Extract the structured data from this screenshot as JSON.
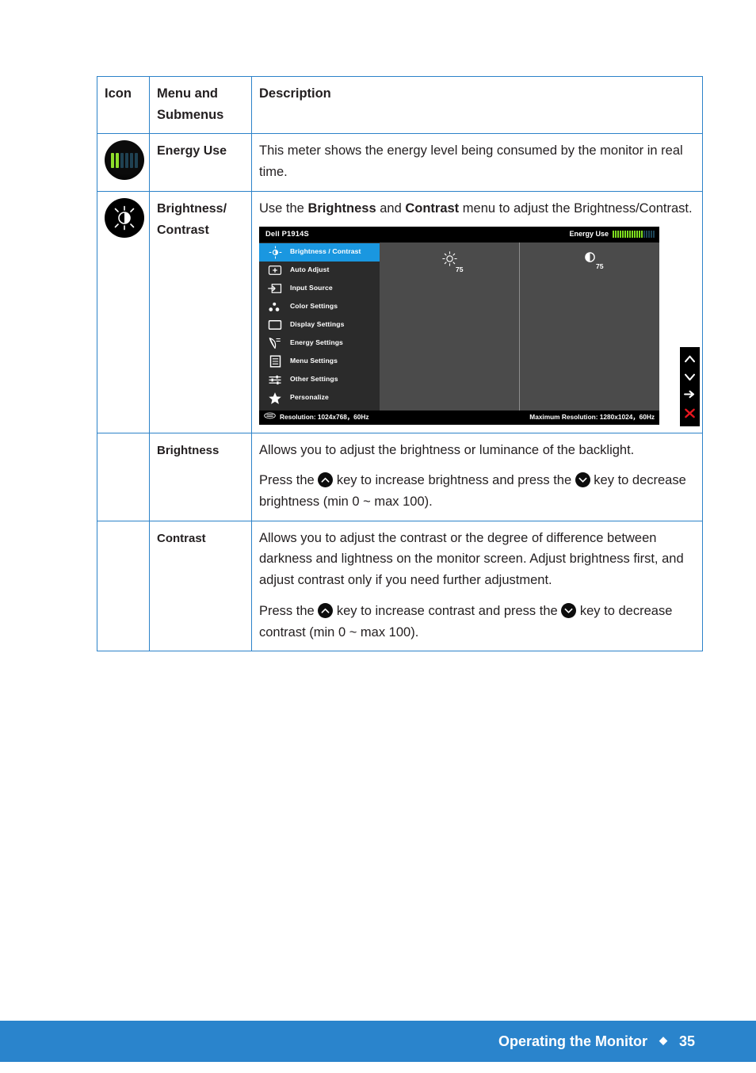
{
  "table": {
    "headers": {
      "icon": "Icon",
      "menu_line1": "Menu and",
      "menu_line2": "Submenus",
      "description": "Description"
    },
    "rows": [
      {
        "icon_name": "energy-use-icon",
        "menu": "Energy Use",
        "desc_paragraphs": [
          "This meter shows the energy level being consumed by the monitor in real time."
        ]
      },
      {
        "icon_name": "brightness-contrast-icon",
        "menu_line1": "Brightness/",
        "menu_line2": "Contrast",
        "desc_intro_1": "Use the ",
        "desc_intro_bold_1": "Brightness",
        "desc_intro_2": " and ",
        "desc_intro_bold_2": "Contrast",
        "desc_intro_3": " menu to adjust the Brightness/Contrast."
      },
      {
        "menu": "Brightness",
        "para1": "Allows you to adjust the brightness or luminance of the backlight.",
        "para2_a": "Press the ",
        "para2_b": " key to increase brightness and press the ",
        "para2_c": " key to decrease brightness (min 0 ~ max 100)."
      },
      {
        "menu": "Contrast",
        "para1": "Allows you to adjust the contrast or the degree of difference between darkness and lightness on the monitor screen. Adjust brightness first, and adjust contrast only if you need further adjustment.",
        "para2_a": "Press the ",
        "para2_b": "  key to increase contrast and press the ",
        "para2_c": " key to decrease contrast (min 0 ~ max 100)."
      }
    ]
  },
  "osd": {
    "title": "Dell P1914S",
    "energy_use_label": "Energy Use",
    "energy_bars_on": 13,
    "energy_bars_off": 5,
    "menu_items": [
      {
        "label": "Brightness / Contrast",
        "icon": "brightness-contrast-icon",
        "active": true
      },
      {
        "label": "Auto Adjust",
        "icon": "auto-adjust-icon",
        "active": false
      },
      {
        "label": "Input Source",
        "icon": "input-source-icon",
        "active": false
      },
      {
        "label": "Color Settings",
        "icon": "color-settings-icon",
        "active": false
      },
      {
        "label": "Display Settings",
        "icon": "display-settings-icon",
        "active": false
      },
      {
        "label": "Energy Settings",
        "icon": "energy-settings-icon",
        "active": false
      },
      {
        "label": "Menu Settings",
        "icon": "menu-settings-icon",
        "active": false
      },
      {
        "label": "Other Settings",
        "icon": "other-settings-icon",
        "active": false
      },
      {
        "label": "Personalize",
        "icon": "personalize-star-icon",
        "active": false
      }
    ],
    "brightness_value": "75",
    "contrast_value": "75",
    "brightness_percent": 75,
    "contrast_percent": 75,
    "resolution": "Resolution: 1024x768，60Hz",
    "max_resolution": "Maximum Resolution: 1280x1024，60Hz",
    "side_keys": [
      "up-chevron-icon",
      "down-chevron-icon",
      "right-arrow-icon",
      "close-x-icon"
    ],
    "colors": {
      "highlight": "#1a97e0",
      "menu_bg": "#2b2b2b",
      "panel_bg": "#4b4b4b",
      "bar_bg": "#000000",
      "energy_green": "#7ede1f",
      "close_red": "#e8161f"
    }
  },
  "footer": {
    "title": "Operating the Monitor",
    "separator": "◆",
    "page": "35",
    "bar_color": "#2a84cc"
  }
}
